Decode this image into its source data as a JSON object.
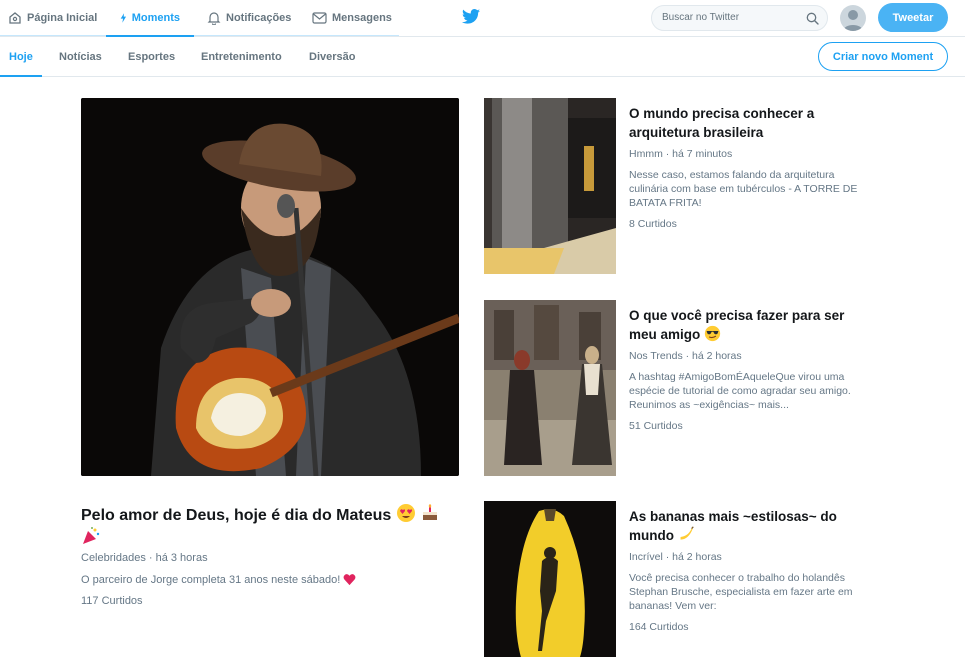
{
  "topnav": {
    "home": "Página Inicial",
    "moments": "Moments",
    "notifications": "Notificações",
    "messages": "Mensagens",
    "search_placeholder": "Buscar no Twitter",
    "tweet_button": "Tweetar"
  },
  "tabs": [
    {
      "label": "Hoje",
      "active": true
    },
    {
      "label": "Notícias",
      "active": false
    },
    {
      "label": "Esportes",
      "active": false
    },
    {
      "label": "Entretenimento",
      "active": false
    },
    {
      "label": "Diversão",
      "active": false
    }
  ],
  "new_moment_button": "Criar novo Moment",
  "hero": {
    "title": "Pelo amor de Deus, hoje é dia do Mateus",
    "meta": "Celebridades · há 3 horas",
    "description": "O parceiro de Jorge completa 31 anos neste sábado!",
    "likes": "117 Curtidos"
  },
  "cards": [
    {
      "title": "O mundo precisa conhecer a arquitetura brasileira",
      "meta": "Hmmm · há 7 minutos",
      "description": "Nesse caso, estamos falando da arquitetura culinária com base em tubérculos - A TORRE DE BATATA FRITA!",
      "likes": "8 Curtidos"
    },
    {
      "title": "O que você precisa fazer para ser meu amigo",
      "meta": "Nos Trends · há 2 horas",
      "description": "A hashtag #AmigoBomÉAqueleQue virou uma espécie de tutorial de como agradar seu amigo. Reunimos as ~exigências~ mais...",
      "likes": "51 Curtidos"
    },
    {
      "title": "As bananas mais ~estilosas~ do mundo",
      "meta": "Incrível · há 2 horas",
      "description": "Você precisa conhecer o trabalho do holandês Stephan Brusche, especialista em fazer arte em bananas! Vem ver:",
      "likes": "164 Curtidos"
    }
  ],
  "colors": {
    "accent": "#1da1f2",
    "text": "#14171a",
    "muted": "#657786"
  }
}
